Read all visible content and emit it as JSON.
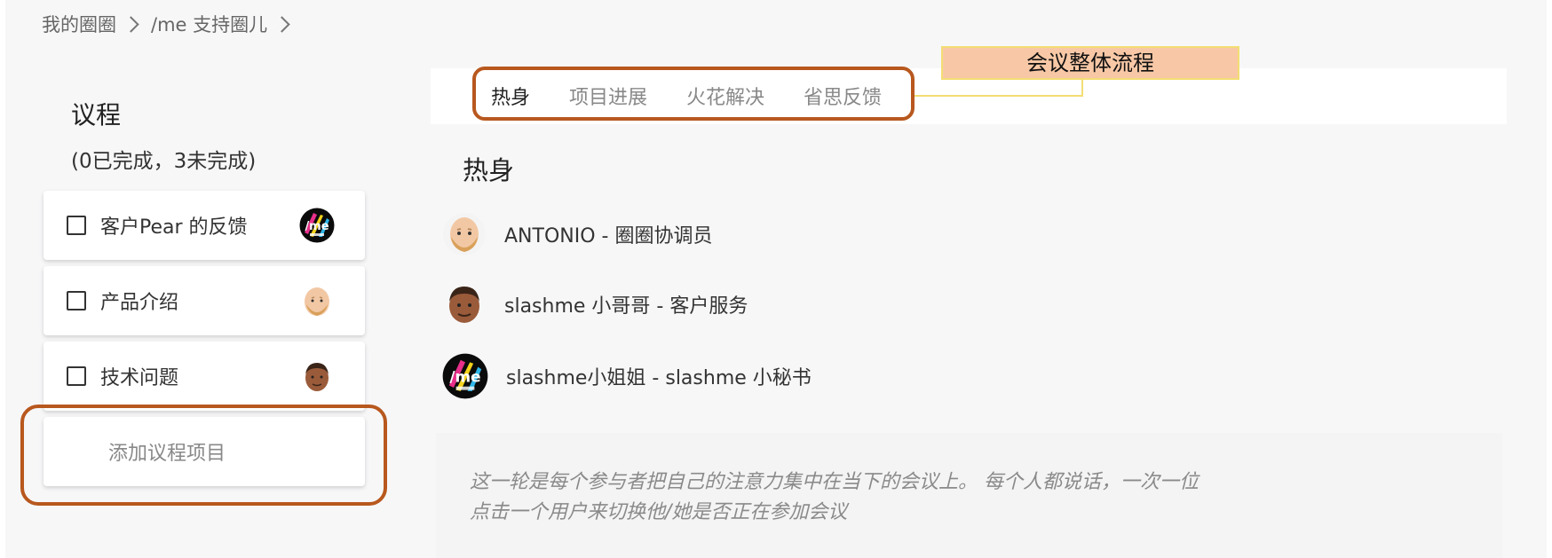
{
  "breadcrumb": {
    "item1": "我的圈圈",
    "item2": "/me 支持圈儿"
  },
  "sidebar": {
    "title": "议程",
    "status": "(0已完成，3未完成)",
    "items": [
      {
        "label": "客户Pear 的反馈",
        "avatar": "slashme-logo-avatar"
      },
      {
        "label": "产品介绍",
        "avatar": "bald-man-avatar"
      },
      {
        "label": "技术问题",
        "avatar": "dark-skin-man-avatar"
      }
    ],
    "add_label": "添加议程项目"
  },
  "tabs": [
    "热身",
    "项目进展",
    "火花解决",
    "省思反馈"
  ],
  "active_tab": "热身",
  "callout": "会议整体流程",
  "section": {
    "title": "热身",
    "participants": [
      {
        "label": "ANTONIO - 圈圈协调员",
        "avatar": "bald-man-avatar"
      },
      {
        "label": "slashme 小哥哥 - 客户服务",
        "avatar": "dark-skin-man-avatar"
      },
      {
        "label": "slashme小姐姐 - slashme 小秘书",
        "avatar": "slashme-logo-avatar"
      }
    ],
    "info_line1": "这一轮是每个参与者把自己的注意力集中在当下的会议上。 每个人都说话，一次一位",
    "info_line2": "点击一个用户来切换他/她是否正在参加会议"
  },
  "colors": {
    "highlight_border": "#b8581e",
    "callout_bg": "#f8c8a6",
    "callout_border": "#f3dd74"
  }
}
